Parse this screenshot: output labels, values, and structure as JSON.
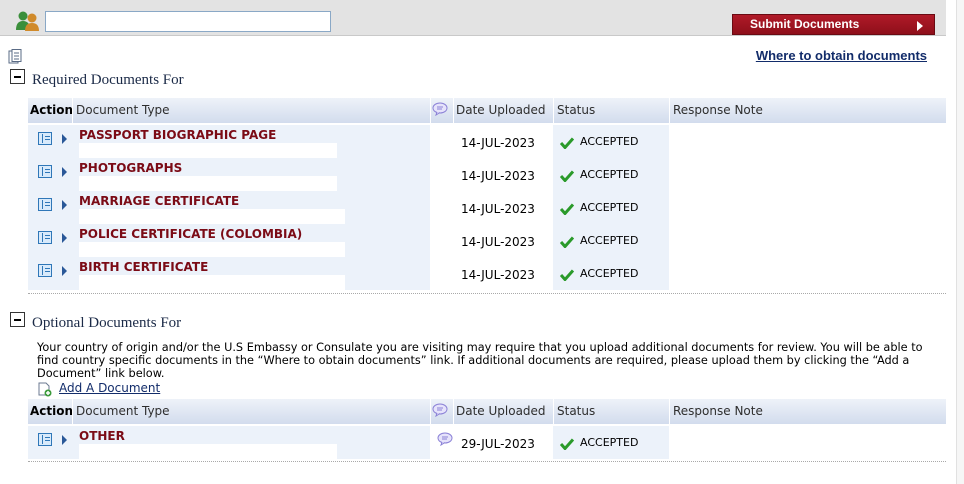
{
  "toolbar": {
    "search_value": "",
    "submit_label": "Submit Documents",
    "where_link": "Where to obtain documents"
  },
  "required": {
    "title": "Required Documents For",
    "headers": {
      "action": "Action",
      "document_type": "Document Type",
      "date_uploaded": "Date Uploaded",
      "status": "Status",
      "response_note": "Response Note"
    },
    "rows": [
      {
        "doc_type": "PASSPORT BIOGRAPHIC PAGE",
        "date": "14-JUL-2023",
        "status": "ACCEPTED"
      },
      {
        "doc_type": "PHOTOGRAPHS",
        "date": "14-JUL-2023",
        "status": "ACCEPTED"
      },
      {
        "doc_type": "MARRIAGE CERTIFICATE",
        "date": "14-JUL-2023",
        "status": "ACCEPTED"
      },
      {
        "doc_type": "POLICE CERTIFICATE (COLOMBIA)",
        "date": "14-JUL-2023",
        "status": "ACCEPTED"
      },
      {
        "doc_type": "BIRTH CERTIFICATE",
        "date": "14-JUL-2023",
        "status": "ACCEPTED"
      }
    ]
  },
  "optional": {
    "title": "Optional Documents For",
    "description": "Your country of origin and/or the U.S Embassy or Consulate you are visiting may require that you upload additional documents for review. You will be able to find country specific documents in the “Where to obtain documents” link. If additional documents are required, please upload them by clicking the “Add a Document” link below.",
    "add_link": "Add A Document",
    "headers": {
      "action": "Action",
      "document_type": "Document Type",
      "date_uploaded": "Date Uploaded",
      "status": "Status",
      "response_note": "Response Note"
    },
    "rows": [
      {
        "doc_type": "OTHER",
        "date": "29-JUL-2023",
        "status": "ACCEPTED"
      }
    ]
  },
  "icons": {
    "users": "users-icon",
    "page": "page-icon",
    "comment": "comment-icon",
    "check": "check-icon",
    "document": "document-icon",
    "add": "add-document-icon"
  },
  "colors": {
    "accent": "#8e0f1a",
    "doc_type": "#7b0b16",
    "link": "#122c6a",
    "check": "#2a9a2a"
  }
}
